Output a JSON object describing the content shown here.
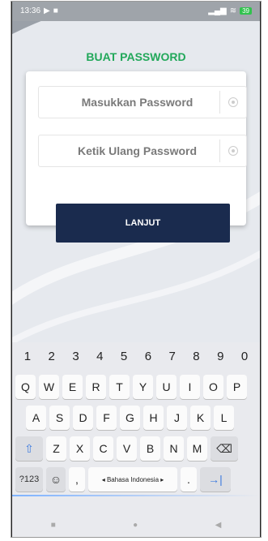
{
  "status": {
    "time": "13:36",
    "battery": "39"
  },
  "page": {
    "title": "BUAT PASSWORD"
  },
  "form": {
    "password_placeholder": "Masukkan Password",
    "confirm_placeholder": "Ketik Ulang Password",
    "submit_label": "LANJUT"
  },
  "keyboard": {
    "numbers": [
      "1",
      "2",
      "3",
      "4",
      "5",
      "6",
      "7",
      "8",
      "9",
      "0"
    ],
    "row1": [
      "Q",
      "W",
      "E",
      "R",
      "T",
      "Y",
      "U",
      "I",
      "O",
      "P"
    ],
    "row2": [
      "A",
      "S",
      "D",
      "F",
      "G",
      "H",
      "J",
      "K",
      "L"
    ],
    "row3": [
      "Z",
      "X",
      "C",
      "V",
      "B",
      "N",
      "M"
    ],
    "mode_label": "?123",
    "space_label": "◂ Bahasa Indonesia ▸",
    "period_label": "."
  },
  "colors": {
    "title": "#22a85a",
    "button_bg": "#1a2b4e"
  }
}
